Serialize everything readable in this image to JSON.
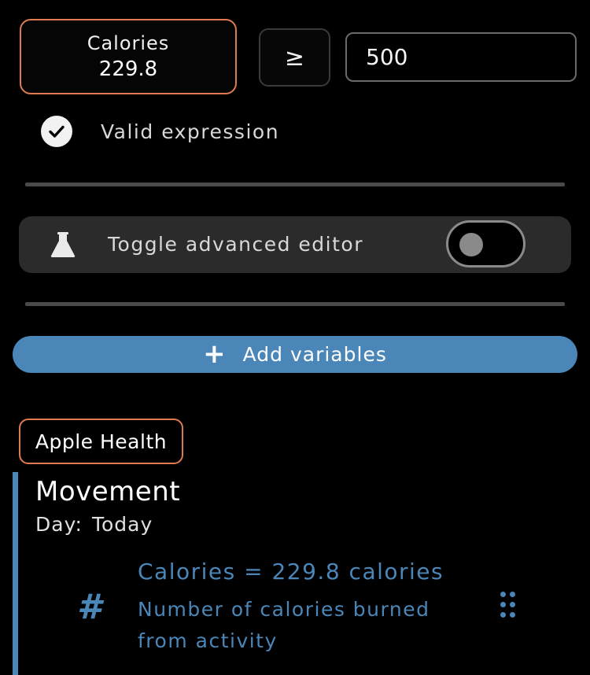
{
  "variable_chip": {
    "name": "Calories",
    "value": "229.8"
  },
  "operator": {
    "symbol": "≥"
  },
  "value_input": {
    "value": "500"
  },
  "validation": {
    "text": "Valid expression",
    "icon": "check-circle-icon"
  },
  "advanced_editor": {
    "label": "Toggle advanced editor",
    "icon": "flask-icon",
    "enabled": false
  },
  "add_variables": {
    "label": "Add variables",
    "icon": "plus-icon"
  },
  "source": {
    "label": "Apple Health"
  },
  "group": {
    "title": "Movement",
    "day_label": "Day:",
    "day_value": "Today"
  },
  "variable_item": {
    "icon": "hash-icon",
    "title": "Calories = 229.8 calories",
    "description": "Number of calories burned from activity"
  },
  "colors": {
    "accent_orange": "#e07a50",
    "accent_blue": "#4a86b8",
    "panel": "#2b2b2b"
  }
}
